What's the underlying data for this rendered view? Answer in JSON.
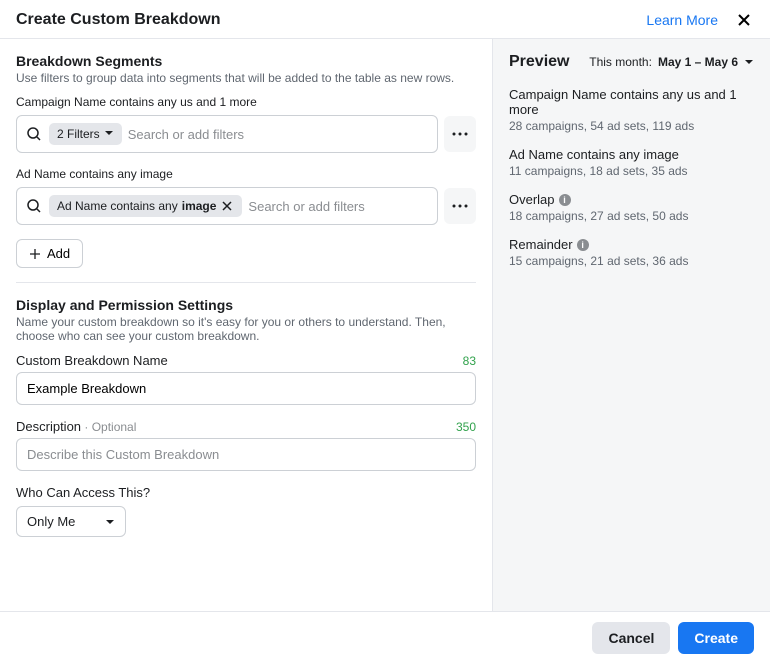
{
  "header": {
    "title": "Create Custom Breakdown",
    "learn_more": "Learn More"
  },
  "segments": {
    "title": "Breakdown Segments",
    "subtitle": "Use filters to group data into segments that will be added to the table as new rows.",
    "items": [
      {
        "label": "Campaign Name contains any us and 1 more",
        "chip_prefix": "2 Filters",
        "chip_bold": "",
        "has_close": false,
        "has_caret": true,
        "placeholder": "Search or add filters"
      },
      {
        "label": "Ad Name contains any image",
        "chip_prefix": "Ad Name contains any ",
        "chip_bold": "image",
        "has_close": true,
        "has_caret": false,
        "placeholder": "Search or add filters"
      }
    ],
    "add_label": "Add"
  },
  "display": {
    "title": "Display and Permission Settings",
    "subtitle": "Name your custom breakdown so it's easy for you or others to understand. Then, choose who can see your custom breakdown.",
    "name_label": "Custom Breakdown Name",
    "name_value": "Example Breakdown",
    "name_counter": "83",
    "desc_label": "Description",
    "desc_optional": " · Optional",
    "desc_placeholder": "Describe this Custom Breakdown",
    "desc_counter": "350",
    "access_label": "Who Can Access This?",
    "access_value": "Only Me"
  },
  "preview": {
    "title": "Preview",
    "date_label": "This month:",
    "date_range": "May 1 – May 6",
    "items": [
      {
        "name": "Campaign Name contains any us and 1 more",
        "stats": "28 campaigns, 54 ad sets, 119 ads",
        "info": false
      },
      {
        "name": "Ad Name contains any image",
        "stats": "11 campaigns, 18 ad sets, 35 ads",
        "info": false
      },
      {
        "name": "Overlap",
        "stats": "18 campaigns, 27 ad sets, 50 ads",
        "info": true
      },
      {
        "name": "Remainder",
        "stats": "15 campaigns, 21 ad sets, 36 ads",
        "info": true
      }
    ]
  },
  "footer": {
    "cancel": "Cancel",
    "create": "Create"
  }
}
